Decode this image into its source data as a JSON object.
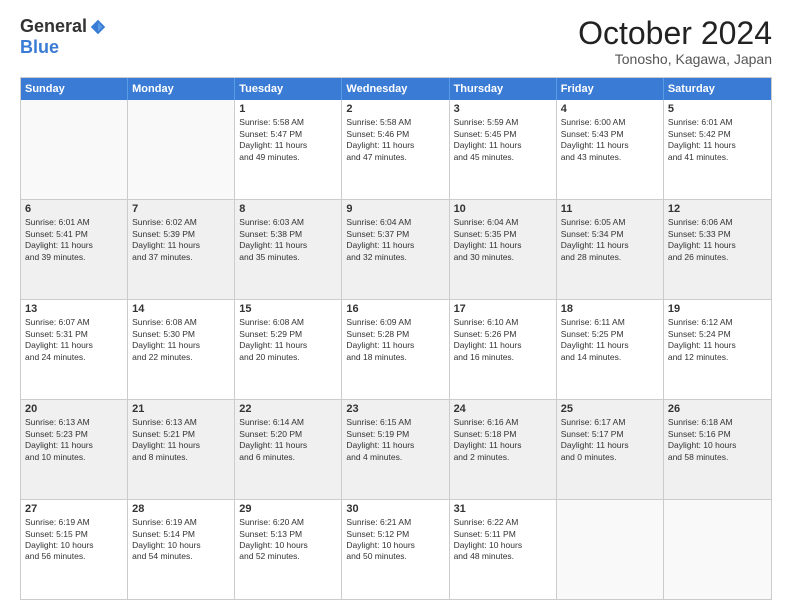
{
  "logo": {
    "general": "General",
    "blue": "Blue"
  },
  "header": {
    "month": "October 2024",
    "location": "Tonosho, Kagawa, Japan"
  },
  "weekdays": [
    "Sunday",
    "Monday",
    "Tuesday",
    "Wednesday",
    "Thursday",
    "Friday",
    "Saturday"
  ],
  "rows": [
    [
      {
        "day": "",
        "empty": true
      },
      {
        "day": "",
        "empty": true
      },
      {
        "day": "1",
        "line1": "Sunrise: 5:58 AM",
        "line2": "Sunset: 5:47 PM",
        "line3": "Daylight: 11 hours",
        "line4": "and 49 minutes."
      },
      {
        "day": "2",
        "line1": "Sunrise: 5:58 AM",
        "line2": "Sunset: 5:46 PM",
        "line3": "Daylight: 11 hours",
        "line4": "and 47 minutes."
      },
      {
        "day": "3",
        "line1": "Sunrise: 5:59 AM",
        "line2": "Sunset: 5:45 PM",
        "line3": "Daylight: 11 hours",
        "line4": "and 45 minutes."
      },
      {
        "day": "4",
        "line1": "Sunrise: 6:00 AM",
        "line2": "Sunset: 5:43 PM",
        "line3": "Daylight: 11 hours",
        "line4": "and 43 minutes."
      },
      {
        "day": "5",
        "line1": "Sunrise: 6:01 AM",
        "line2": "Sunset: 5:42 PM",
        "line3": "Daylight: 11 hours",
        "line4": "and 41 minutes."
      }
    ],
    [
      {
        "day": "6",
        "line1": "Sunrise: 6:01 AM",
        "line2": "Sunset: 5:41 PM",
        "line3": "Daylight: 11 hours",
        "line4": "and 39 minutes."
      },
      {
        "day": "7",
        "line1": "Sunrise: 6:02 AM",
        "line2": "Sunset: 5:39 PM",
        "line3": "Daylight: 11 hours",
        "line4": "and 37 minutes."
      },
      {
        "day": "8",
        "line1": "Sunrise: 6:03 AM",
        "line2": "Sunset: 5:38 PM",
        "line3": "Daylight: 11 hours",
        "line4": "and 35 minutes."
      },
      {
        "day": "9",
        "line1": "Sunrise: 6:04 AM",
        "line2": "Sunset: 5:37 PM",
        "line3": "Daylight: 11 hours",
        "line4": "and 32 minutes."
      },
      {
        "day": "10",
        "line1": "Sunrise: 6:04 AM",
        "line2": "Sunset: 5:35 PM",
        "line3": "Daylight: 11 hours",
        "line4": "and 30 minutes."
      },
      {
        "day": "11",
        "line1": "Sunrise: 6:05 AM",
        "line2": "Sunset: 5:34 PM",
        "line3": "Daylight: 11 hours",
        "line4": "and 28 minutes."
      },
      {
        "day": "12",
        "line1": "Sunrise: 6:06 AM",
        "line2": "Sunset: 5:33 PM",
        "line3": "Daylight: 11 hours",
        "line4": "and 26 minutes."
      }
    ],
    [
      {
        "day": "13",
        "line1": "Sunrise: 6:07 AM",
        "line2": "Sunset: 5:31 PM",
        "line3": "Daylight: 11 hours",
        "line4": "and 24 minutes."
      },
      {
        "day": "14",
        "line1": "Sunrise: 6:08 AM",
        "line2": "Sunset: 5:30 PM",
        "line3": "Daylight: 11 hours",
        "line4": "and 22 minutes."
      },
      {
        "day": "15",
        "line1": "Sunrise: 6:08 AM",
        "line2": "Sunset: 5:29 PM",
        "line3": "Daylight: 11 hours",
        "line4": "and 20 minutes."
      },
      {
        "day": "16",
        "line1": "Sunrise: 6:09 AM",
        "line2": "Sunset: 5:28 PM",
        "line3": "Daylight: 11 hours",
        "line4": "and 18 minutes."
      },
      {
        "day": "17",
        "line1": "Sunrise: 6:10 AM",
        "line2": "Sunset: 5:26 PM",
        "line3": "Daylight: 11 hours",
        "line4": "and 16 minutes."
      },
      {
        "day": "18",
        "line1": "Sunrise: 6:11 AM",
        "line2": "Sunset: 5:25 PM",
        "line3": "Daylight: 11 hours",
        "line4": "and 14 minutes."
      },
      {
        "day": "19",
        "line1": "Sunrise: 6:12 AM",
        "line2": "Sunset: 5:24 PM",
        "line3": "Daylight: 11 hours",
        "line4": "and 12 minutes."
      }
    ],
    [
      {
        "day": "20",
        "line1": "Sunrise: 6:13 AM",
        "line2": "Sunset: 5:23 PM",
        "line3": "Daylight: 11 hours",
        "line4": "and 10 minutes."
      },
      {
        "day": "21",
        "line1": "Sunrise: 6:13 AM",
        "line2": "Sunset: 5:21 PM",
        "line3": "Daylight: 11 hours",
        "line4": "and 8 minutes."
      },
      {
        "day": "22",
        "line1": "Sunrise: 6:14 AM",
        "line2": "Sunset: 5:20 PM",
        "line3": "Daylight: 11 hours",
        "line4": "and 6 minutes."
      },
      {
        "day": "23",
        "line1": "Sunrise: 6:15 AM",
        "line2": "Sunset: 5:19 PM",
        "line3": "Daylight: 11 hours",
        "line4": "and 4 minutes."
      },
      {
        "day": "24",
        "line1": "Sunrise: 6:16 AM",
        "line2": "Sunset: 5:18 PM",
        "line3": "Daylight: 11 hours",
        "line4": "and 2 minutes."
      },
      {
        "day": "25",
        "line1": "Sunrise: 6:17 AM",
        "line2": "Sunset: 5:17 PM",
        "line3": "Daylight: 11 hours",
        "line4": "and 0 minutes."
      },
      {
        "day": "26",
        "line1": "Sunrise: 6:18 AM",
        "line2": "Sunset: 5:16 PM",
        "line3": "Daylight: 10 hours",
        "line4": "and 58 minutes."
      }
    ],
    [
      {
        "day": "27",
        "line1": "Sunrise: 6:19 AM",
        "line2": "Sunset: 5:15 PM",
        "line3": "Daylight: 10 hours",
        "line4": "and 56 minutes."
      },
      {
        "day": "28",
        "line1": "Sunrise: 6:19 AM",
        "line2": "Sunset: 5:14 PM",
        "line3": "Daylight: 10 hours",
        "line4": "and 54 minutes."
      },
      {
        "day": "29",
        "line1": "Sunrise: 6:20 AM",
        "line2": "Sunset: 5:13 PM",
        "line3": "Daylight: 10 hours",
        "line4": "and 52 minutes."
      },
      {
        "day": "30",
        "line1": "Sunrise: 6:21 AM",
        "line2": "Sunset: 5:12 PM",
        "line3": "Daylight: 10 hours",
        "line4": "and 50 minutes."
      },
      {
        "day": "31",
        "line1": "Sunrise: 6:22 AM",
        "line2": "Sunset: 5:11 PM",
        "line3": "Daylight: 10 hours",
        "line4": "and 48 minutes."
      },
      {
        "day": "",
        "empty": true
      },
      {
        "day": "",
        "empty": true
      }
    ]
  ]
}
